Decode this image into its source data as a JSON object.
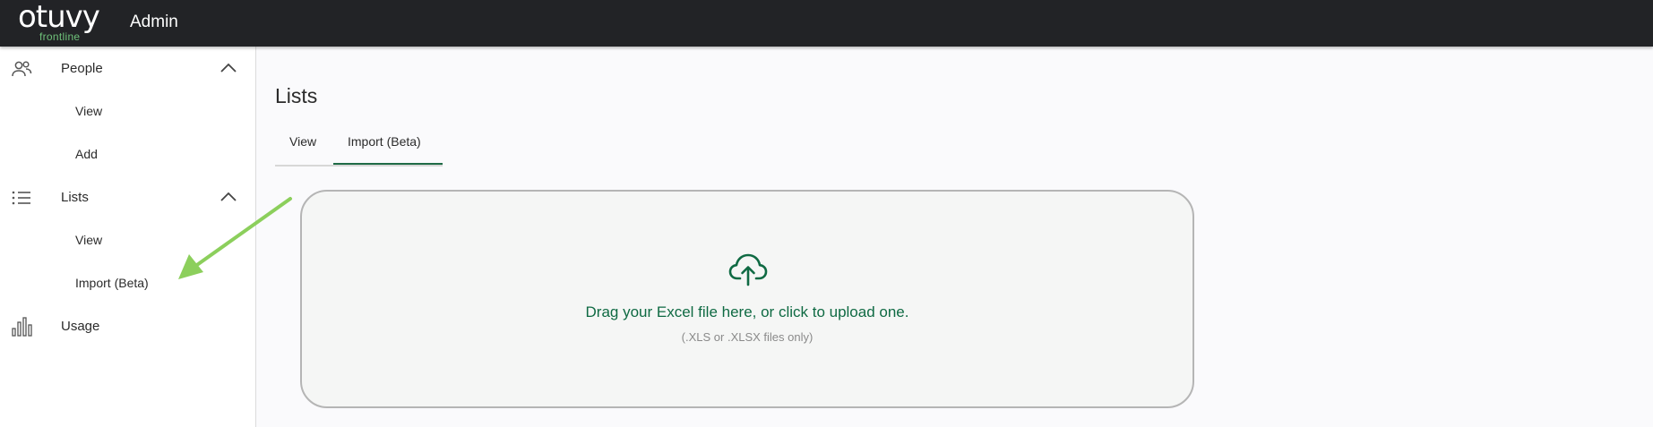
{
  "header": {
    "logo_text": "otuvy",
    "logo_subtext": "frontline",
    "title": "Admin"
  },
  "sidebar": {
    "sections": [
      {
        "label": "People",
        "icon": "people-icon",
        "expanded": true,
        "items": [
          {
            "label": "View"
          },
          {
            "label": "Add"
          }
        ]
      },
      {
        "label": "Lists",
        "icon": "list-icon",
        "expanded": true,
        "items": [
          {
            "label": "View"
          },
          {
            "label": "Import (Beta)"
          }
        ]
      },
      {
        "label": "Usage",
        "icon": "bar-chart-icon",
        "expanded": false,
        "items": []
      }
    ]
  },
  "main": {
    "title": "Lists",
    "tabs": [
      {
        "label": "View",
        "active": false
      },
      {
        "label": "Import (Beta)",
        "active": true
      }
    ],
    "upload": {
      "icon": "cloud-upload-icon",
      "primary_text": "Drag your Excel file here, or click to upload one.",
      "secondary_text": "(.XLS or .XLSX files only)"
    }
  },
  "colors": {
    "topbar": "#222326",
    "brand_green": "#6fc27a",
    "accent_green": "#0f6a43",
    "annotation_arrow": "#8ccf5c"
  }
}
